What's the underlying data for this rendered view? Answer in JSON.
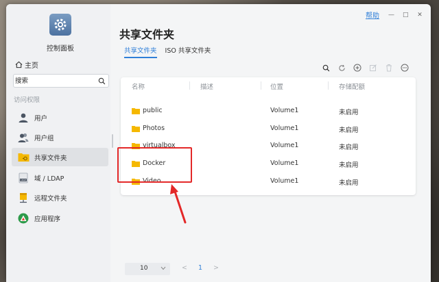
{
  "window": {
    "help_label": "帮助",
    "minimize_glyph": "—",
    "maximize_glyph": "□",
    "close_glyph": "✕"
  },
  "sidebar": {
    "app_title": "控制面板",
    "home_label": "主页",
    "search_placeholder": "搜索",
    "section_title": "访问权限",
    "items": [
      {
        "label": "用户",
        "icon": "user-icon",
        "active": false
      },
      {
        "label": "用户组",
        "icon": "user-group-icon",
        "active": false
      },
      {
        "label": "共享文件夹",
        "icon": "shared-folder-icon",
        "active": true
      },
      {
        "label": "域 / LDAP",
        "icon": "domain-ldap-icon",
        "active": false
      },
      {
        "label": "远程文件夹",
        "icon": "remote-folder-icon",
        "active": false
      },
      {
        "label": "应用程序",
        "icon": "application-icon",
        "active": false
      }
    ]
  },
  "main": {
    "title": "共享文件夹",
    "tabs": [
      {
        "label": "共享文件夹",
        "active": true
      },
      {
        "label": "ISO 共享文件夹",
        "active": false
      }
    ],
    "toolbar": [
      "search-icon",
      "refresh-icon",
      "add-icon",
      "edit-icon",
      "delete-icon",
      "more-icon"
    ],
    "table": {
      "columns": [
        "名称",
        "描述",
        "位置",
        "存储配额"
      ],
      "rows": [
        {
          "name": "public",
          "description": "",
          "location": "Volume1",
          "quota": "未启用"
        },
        {
          "name": "Photos",
          "description": "",
          "location": "Volume1",
          "quota": "未启用"
        },
        {
          "name": "virtualbox",
          "description": "",
          "location": "Volume1",
          "quota": "未启用"
        },
        {
          "name": "Docker",
          "description": "",
          "location": "Volume1",
          "quota": "未启用"
        },
        {
          "name": "Video",
          "description": "",
          "location": "Volume1",
          "quota": "未启用"
        }
      ]
    },
    "pagination": {
      "page_size": "10",
      "current_page": "1",
      "prev_glyph": "<",
      "next_glyph": ">"
    }
  },
  "colors": {
    "accent": "#2f7fd8",
    "folder": "#f5b800",
    "highlight": "#e32828"
  }
}
